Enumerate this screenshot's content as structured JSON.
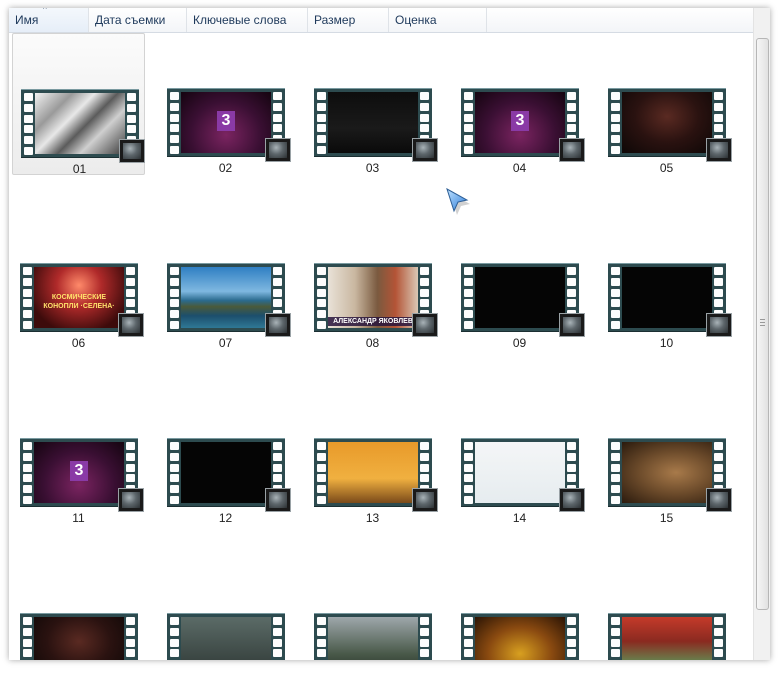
{
  "columns": [
    {
      "label": "Имя",
      "sorted": true
    },
    {
      "label": "Дата съемки"
    },
    {
      "label": "Ключевые слова"
    },
    {
      "label": "Размер"
    },
    {
      "label": "Оценка"
    }
  ],
  "sort_indicator": "^",
  "items": [
    {
      "label": "01",
      "selected": true,
      "thumb": "bw-building"
    },
    {
      "label": "02",
      "thumb": "purple-3"
    },
    {
      "label": "03",
      "thumb": "dark"
    },
    {
      "label": "04",
      "thumb": "purple-3"
    },
    {
      "label": "05",
      "thumb": "dark-red"
    },
    {
      "label": "06",
      "thumb": "yellow-text"
    },
    {
      "label": "07",
      "thumb": "island"
    },
    {
      "label": "08",
      "thumb": "street"
    },
    {
      "label": "09",
      "thumb": "black"
    },
    {
      "label": "10",
      "thumb": "black"
    },
    {
      "label": "11",
      "thumb": "purple-3"
    },
    {
      "label": "12",
      "thumb": "black"
    },
    {
      "label": "13",
      "thumb": "orange-crowd"
    },
    {
      "label": "14",
      "thumb": "white"
    },
    {
      "label": "15",
      "thumb": "brown-texture"
    },
    {
      "label": "",
      "thumb": "dark-red"
    },
    {
      "label": "",
      "thumb": "dark-grey"
    },
    {
      "label": "",
      "thumb": "palm"
    },
    {
      "label": "",
      "thumb": "fire"
    },
    {
      "label": "",
      "thumb": "car"
    }
  ],
  "badge_text": "3",
  "item6_caption": "КОСМИЧЕСКИЕ КОНОПЛИ ·СЕЛЕНА·",
  "item8_caption": "АЛЕКСАНДР ЯКОВЛЕВ",
  "colors": {
    "film_strip": "#2d4b4f",
    "header_text": "#1e395b",
    "badge": "#8a3aa6"
  },
  "icons": {
    "thumbnail_overlay": "video-file-icon",
    "cursor": "mouse-pointer-icon"
  }
}
